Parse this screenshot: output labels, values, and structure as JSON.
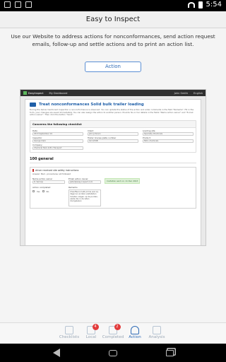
{
  "status_bar": {
    "time": "5:54"
  },
  "app": {
    "title": "Easy to Inspect",
    "intro": "Use our Website to address actions for nonconformances, send action request emails, follow-up and settle actions and to print an action list.",
    "action_button": "Action"
  },
  "website": {
    "logo": "Easyinspect",
    "nav": [
      "My Dashboard"
    ],
    "user": "John Smith",
    "lang": "English",
    "heading": "Treat nonconformances Solid bulk trailer loading",
    "description": "During the below mentioned inspection a nonconformance is observed. You can update the status of the action and enter comments in the field \"Remarks\". Fill in the form, your changes are saved immediately. You can also assign the action to another person. Provide his or her details in the fields \"Name action owner\" and \"E-mail action owner\". Then click the button \"Send\".",
    "checklist_title": "Concerns the following checklist",
    "fields": [
      {
        "label": "Date",
        "value": "2013  September  19"
      },
      {
        "label": "Client",
        "value": "John Johnson"
      },
      {
        "label": "Loading site",
        "value": "Specialty Chemicals"
      },
      {
        "label": "Inspector",
        "value": "George Clark"
      },
      {
        "label": "Trailer license plate number",
        "value": "AV-1234B"
      },
      {
        "label": "Product",
        "value": "Nitro-chemicals"
      },
      {
        "label": "Company",
        "value": "Chemical Tank & Bin Transport"
      }
    ],
    "section": "100 general",
    "question": {
      "title": "driver received site safety instructions",
      "answer": "Answer:  Bad - procedures not followed",
      "owner_label": "Name action owner",
      "owner_value": "R. Verloop",
      "email_label": "Email action owner",
      "email_value": "peter@easy-inspect.com",
      "sent": "Invitation sent on: 11 Dec 2013",
      "completed_label": "Action completed",
      "yes": "Yes",
      "no": "No",
      "remarks_label": "Remarks",
      "remarks": "Chauffeurs hebt prima wel op, dagel en andere vaststellen moeten volgen op de punten, vaste die in de laten doorgelezen"
    }
  },
  "tabs": [
    {
      "label": "Checklists",
      "icon": "checklist-icon",
      "badge": ""
    },
    {
      "label": "Local",
      "icon": "folder-icon",
      "badge": "4"
    },
    {
      "label": "Completed",
      "icon": "inbox-icon",
      "badge": "2"
    },
    {
      "label": "Action",
      "icon": "people-icon",
      "badge": ""
    },
    {
      "label": "Analysis",
      "icon": "analysis-icon",
      "badge": ""
    }
  ],
  "colors": {
    "accent": "#2f6bb6",
    "badge": "#e23b3b",
    "header": "#1f5fa8"
  }
}
